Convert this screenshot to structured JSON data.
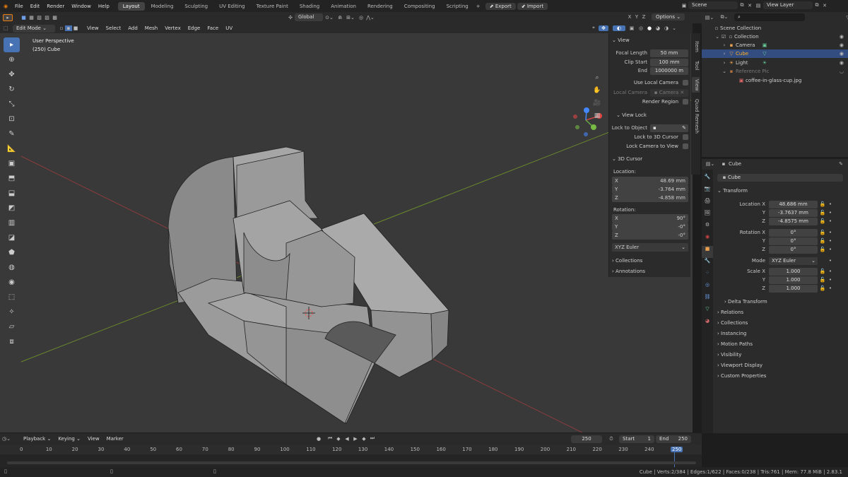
{
  "menu": [
    "File",
    "Edit",
    "Render",
    "Window",
    "Help"
  ],
  "workspaces": [
    "Layout",
    "Modeling",
    "Sculpting",
    "UV Editing",
    "Texture Paint",
    "Shading",
    "Animation",
    "Rendering",
    "Compositing",
    "Scripting"
  ],
  "export_label": "Export",
  "import_label": "Import",
  "scene_name": "Scene",
  "view_layer": "View Layer",
  "vp": {
    "mode": "Edit Mode",
    "menus": [
      "View",
      "Select",
      "Add",
      "Mesh",
      "Vertex",
      "Edge",
      "Face",
      "UV"
    ],
    "orientation": "Global",
    "options": "Options",
    "overlay_title": "User Perspective",
    "overlay_object": "(250) Cube"
  },
  "npanel": {
    "view_header": "View",
    "focal_length_label": "Focal Length",
    "focal_length": "50 mm",
    "clip_start_label": "Clip Start",
    "clip_start": "100 mm",
    "end_label": "End",
    "end": "1000000 m",
    "use_local_camera": "Use Local Camera",
    "local_camera_label": "Local Camera",
    "local_camera_value": "Camera",
    "render_region": "Render Region",
    "view_lock": "View Lock",
    "lock_to_object": "Lock to Object",
    "lock_3d_cursor": "Lock to 3D Cursor",
    "lock_camera": "Lock Camera to View",
    "cursor_header": "3D Cursor",
    "location": "Location:",
    "rotation": "Rotation:",
    "cx": "48.69 mm",
    "cy": "-3.764 mm",
    "cz": "-4.858 mm",
    "rx": "90°",
    "ry": "-0°",
    "rz": "-0°",
    "euler": "XYZ Euler",
    "collections": "Collections",
    "annotations": "Annotations",
    "X": "X",
    "Y": "Y",
    "Z": "Z"
  },
  "vtabs": [
    "Item",
    "Tool",
    "View",
    "Quad Remesh"
  ],
  "outliner": {
    "scene_collection": "Scene Collection",
    "collection": "Collection",
    "camera": "Camera",
    "cube": "Cube",
    "light": "Light",
    "ref": "Reference Pic",
    "image": "coffee-in-glass-cup.jpg"
  },
  "props": {
    "object": "Cube",
    "object2": "Cube",
    "transform": "Transform",
    "loc_x_label": "Location X",
    "loc_x": "48.686 mm",
    "loc_y": "-3.7637 mm",
    "loc_z": "-4.8575 mm",
    "rot_x_label": "Rotation X",
    "rot_x": "0°",
    "rot_y": "0°",
    "rot_z": "0°",
    "mode_label": "Mode",
    "mode": "XYZ Euler",
    "scale_x_label": "Scale X",
    "sx": "1.000",
    "sy": "1.000",
    "sz": "1.000",
    "Y": "Y",
    "Z": "Z",
    "sections": [
      "Delta Transform",
      "Relations",
      "Collections",
      "Instancing",
      "Motion Paths",
      "Visibility",
      "Viewport Display",
      "Custom Properties"
    ]
  },
  "timeline": {
    "menus": [
      "Playback",
      "Keying",
      "View",
      "Marker"
    ],
    "current": "250",
    "start_label": "Start",
    "start": "1",
    "end_label": "End",
    "end": "250",
    "ticks": [
      "0",
      "10",
      "20",
      "30",
      "40",
      "50",
      "60",
      "70",
      "80",
      "90",
      "100",
      "110",
      "120",
      "130",
      "140",
      "150",
      "160",
      "170",
      "180",
      "190",
      "200",
      "210",
      "220",
      "230",
      "240",
      "250"
    ]
  },
  "status": "Cube | Verts:2/384 | Edges:1/622 | Faces:0/238 | Tris:761 | Mem: 77.8 MiB | 2.83.1"
}
